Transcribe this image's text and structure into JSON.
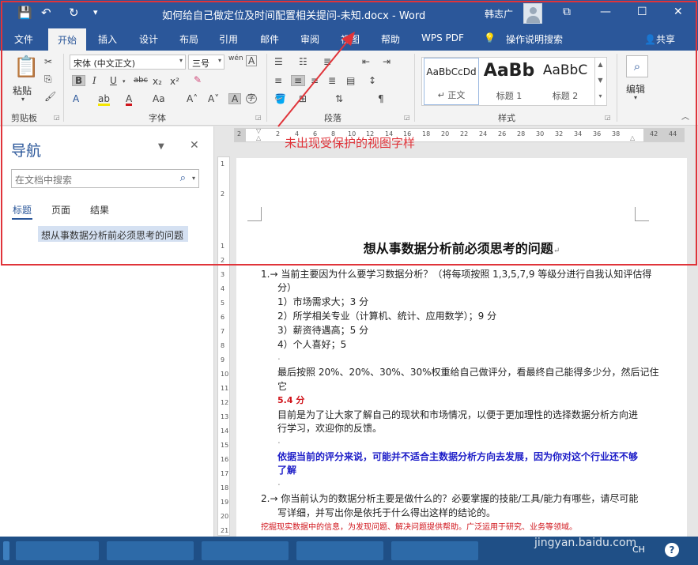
{
  "window": {
    "title": "如何给自己做定位及时间配置相关提问-未知.docx  -  Word",
    "user": "韩志广",
    "qat_save": "💾",
    "qat_undo": "↶",
    "qat_redo": "↻",
    "qat_more": "▾",
    "ribbon_display": "⧉",
    "minimize": "—",
    "maximize": "☐",
    "close": "✕"
  },
  "tabs": [
    "文件",
    "开始",
    "插入",
    "设计",
    "布局",
    "引用",
    "邮件",
    "审阅",
    "视图",
    "帮助",
    "WPS PDF"
  ],
  "tell_me": "操作说明搜索",
  "share": "共享",
  "ribbon": {
    "paste": "粘贴",
    "clipboard_label": "剪贴板",
    "font_name": "宋体 (中文正文)",
    "font_size": "三号",
    "font_label": "字体",
    "paragraph_label": "段落",
    "styles_label": "样式",
    "editing": "编辑",
    "styles": [
      {
        "sample": "AaBbCcDd",
        "name": "↵ 正文"
      },
      {
        "sample": "AaBb",
        "name": "标题 1"
      },
      {
        "sample": "AaBbC",
        "name": "标题 2"
      }
    ],
    "font_buttons": {
      "bold": "B",
      "italic": "I",
      "underline": "U",
      "strike": "abc",
      "subscript": "x₂",
      "superscript": "x²",
      "grow": "A˄",
      "shrink": "A˅",
      "case": "Aa",
      "wen": "wén",
      "border_a": "A",
      "effects": "A",
      "highlight": "ab",
      "color": "A",
      "char_shade": "A",
      "enclose": "字"
    }
  },
  "nav": {
    "title": "导航",
    "search_placeholder": "在文档中搜索",
    "tabs": [
      "标题",
      "页面",
      "结果"
    ],
    "heading": "想从事数据分析前必须思考的问题"
  },
  "ruler": {
    "h_ticks": [
      "2",
      "2",
      "4",
      "6",
      "8",
      "10",
      "12",
      "14",
      "16",
      "18",
      "20",
      "22",
      "24",
      "26",
      "28",
      "30",
      "32",
      "34",
      "36",
      "38",
      "42",
      "44"
    ],
    "v_ticks": [
      "1",
      "2",
      "1",
      "2",
      "3",
      "4",
      "5",
      "6",
      "7",
      "8",
      "9",
      "10",
      "11",
      "12",
      "13",
      "14",
      "15",
      "16",
      "17",
      "18",
      "19",
      "20",
      "21"
    ]
  },
  "document": {
    "title": "想从事数据分析前必须思考的问题",
    "lines": {
      "q1a": "1.→ 当前主要因为什么要学习数据分析？（将每项按照 1,3,5,7,9 等级分进行自我认知评估得",
      "q1b": "分）",
      "o1": "1）市场需求大；3 分",
      "o2": "2）所学相关专业（计算机、统计、应用数学）；9 分",
      "o3": "3）薪资待遇高；5 分",
      "o4": "4）个人喜好；5",
      "weight_a": "最后按照 20%、20%、30%、30%权重给自己做评分，看最终自己能得多少分，然后记住",
      "weight_b": "它",
      "score": "5.4 分",
      "purpose_a": "目前是为了让大家了解自己的现状和市场情况，以便于更加理性的选择数据分析方向进",
      "purpose_b": "行学习，欢迎你的反馈。",
      "blue_a": "依据当前的评分来说，可能并不适合主数据分析方向去发展，因为你对这个行业还不够",
      "blue_b": "了解",
      "q2a": "2.→ 你当前认为的数据分析主要是做什么的？必要掌握的技能/工具/能力有哪些，请尽可能",
      "q2b": "写详细，并写出你是依托于什么得出这样的结论的。",
      "footer": "挖掘现实数据中的信息，为发现问题、解决问题提供帮助。广泛运用于研究、业务等领域。"
    },
    "para_mark": "↵",
    "small_mark": "."
  },
  "annotation": {
    "text": "未出现受保护的视图字样",
    "color": "#e0343a"
  },
  "taskbar": {
    "ime": "CH",
    "watermark": "jingyan.baidu.com",
    "help": "?"
  },
  "colors": {
    "brand": "#2b579a",
    "annotation": "#e0343a",
    "doc_red": "#d0141b",
    "doc_blue": "#1e1ec8"
  }
}
